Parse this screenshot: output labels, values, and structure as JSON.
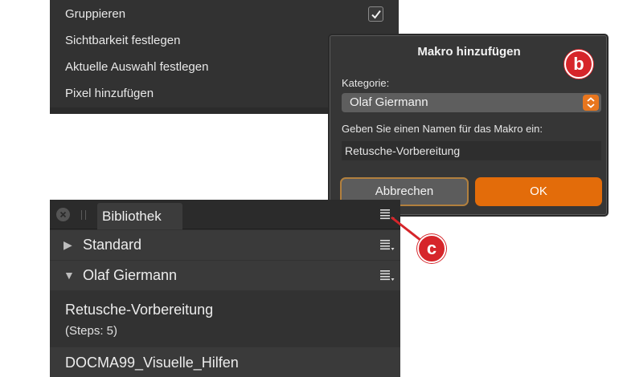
{
  "menu": {
    "items": [
      {
        "label": "Gruppieren",
        "checked": true
      },
      {
        "label": "Sichtbarkeit festlegen",
        "checked": true
      },
      {
        "label": "Aktuelle Auswahl festlegen",
        "checked": false
      },
      {
        "label": "Pixel hinzufügen",
        "checked": false
      }
    ]
  },
  "dialog": {
    "title": "Makro hinzufügen",
    "category_label": "Kategorie:",
    "category_value": "Olaf Giermann",
    "name_label": "Geben Sie einen Namen für das Makro ein:",
    "name_value": "Retusche-Vorbereitung",
    "cancel_label": "Abbrechen",
    "ok_label": "OK"
  },
  "callouts": {
    "b": "b",
    "c": "c",
    "color": "#d6252a"
  },
  "library": {
    "tab_label": "Bibliothek",
    "categories": [
      {
        "label": "Standard",
        "expanded": false
      },
      {
        "label": "Olaf Giermann",
        "expanded": true
      }
    ],
    "macros": [
      {
        "name": "Retusche-Vorbereitung",
        "steps": "(Steps: 5)"
      },
      {
        "name": "DOCMA99_Visuelle_Hilfen"
      }
    ]
  },
  "colors": {
    "accent": "#e36c0a",
    "panel": "#323232",
    "callout": "#d6252a"
  }
}
